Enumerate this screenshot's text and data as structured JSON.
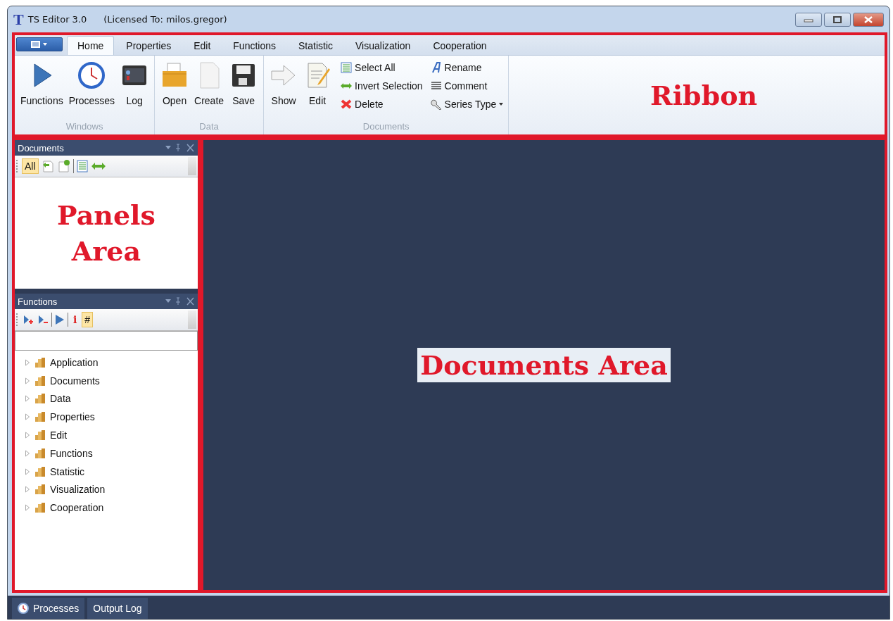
{
  "window": {
    "logo": "T",
    "title": "TS Editor 3.0",
    "license": "(Licensed To: milos.gregor)"
  },
  "ribbon": {
    "annotation": "Ribbon",
    "tabs": [
      {
        "label": "Home",
        "selected": true
      },
      {
        "label": "Properties",
        "selected": false
      },
      {
        "label": "Edit",
        "selected": false
      },
      {
        "label": "Functions",
        "selected": false
      },
      {
        "label": "Statistic",
        "selected": false
      },
      {
        "label": "Visualization",
        "selected": false
      },
      {
        "label": "Cooperation",
        "selected": false
      }
    ],
    "groups": [
      {
        "label": "Windows",
        "items": [
          {
            "kind": "large",
            "label": "Functions"
          },
          {
            "kind": "large",
            "label": "Processes"
          },
          {
            "kind": "large",
            "label": "Log"
          }
        ]
      },
      {
        "label": "Data",
        "items": [
          {
            "kind": "large",
            "label": "Open"
          },
          {
            "kind": "large",
            "label": "Create"
          },
          {
            "kind": "large",
            "label": "Save"
          }
        ]
      },
      {
        "label": "Documents",
        "items": [
          {
            "kind": "large",
            "label": "Show"
          },
          {
            "kind": "large",
            "label": "Edit"
          },
          {
            "kind": "small",
            "label": "Select All"
          },
          {
            "kind": "small",
            "label": "Invert Selection"
          },
          {
            "kind": "small",
            "label": "Delete"
          },
          {
            "kind": "small",
            "label": "Rename"
          },
          {
            "kind": "small",
            "label": "Comment"
          },
          {
            "kind": "dropdown",
            "label": "Series Type"
          }
        ]
      }
    ]
  },
  "panels": {
    "annotation": "Panels Area",
    "documents": {
      "title": "Documents",
      "toolbar": [
        {
          "label": "All",
          "selected": true
        }
      ]
    },
    "functions": {
      "title": "Functions",
      "toolbar": [
        {
          "label": "i",
          "selected": false
        },
        {
          "label": "#",
          "selected": true
        }
      ],
      "tree": [
        {
          "label": "Application",
          "expanded": false
        },
        {
          "label": "Documents",
          "expanded": false
        },
        {
          "label": "Data",
          "expanded": false
        },
        {
          "label": "Properties",
          "expanded": false
        },
        {
          "label": "Edit",
          "expanded": false
        },
        {
          "label": "Functions",
          "expanded": false
        },
        {
          "label": "Statistic",
          "expanded": false
        },
        {
          "label": "Visualization",
          "expanded": false
        },
        {
          "label": "Cooperation",
          "expanded": false
        }
      ]
    }
  },
  "documents_area": {
    "annotation": "Documents Area"
  },
  "bottom_tabs": [
    {
      "label": "Processes"
    },
    {
      "label": "Output Log"
    }
  ]
}
